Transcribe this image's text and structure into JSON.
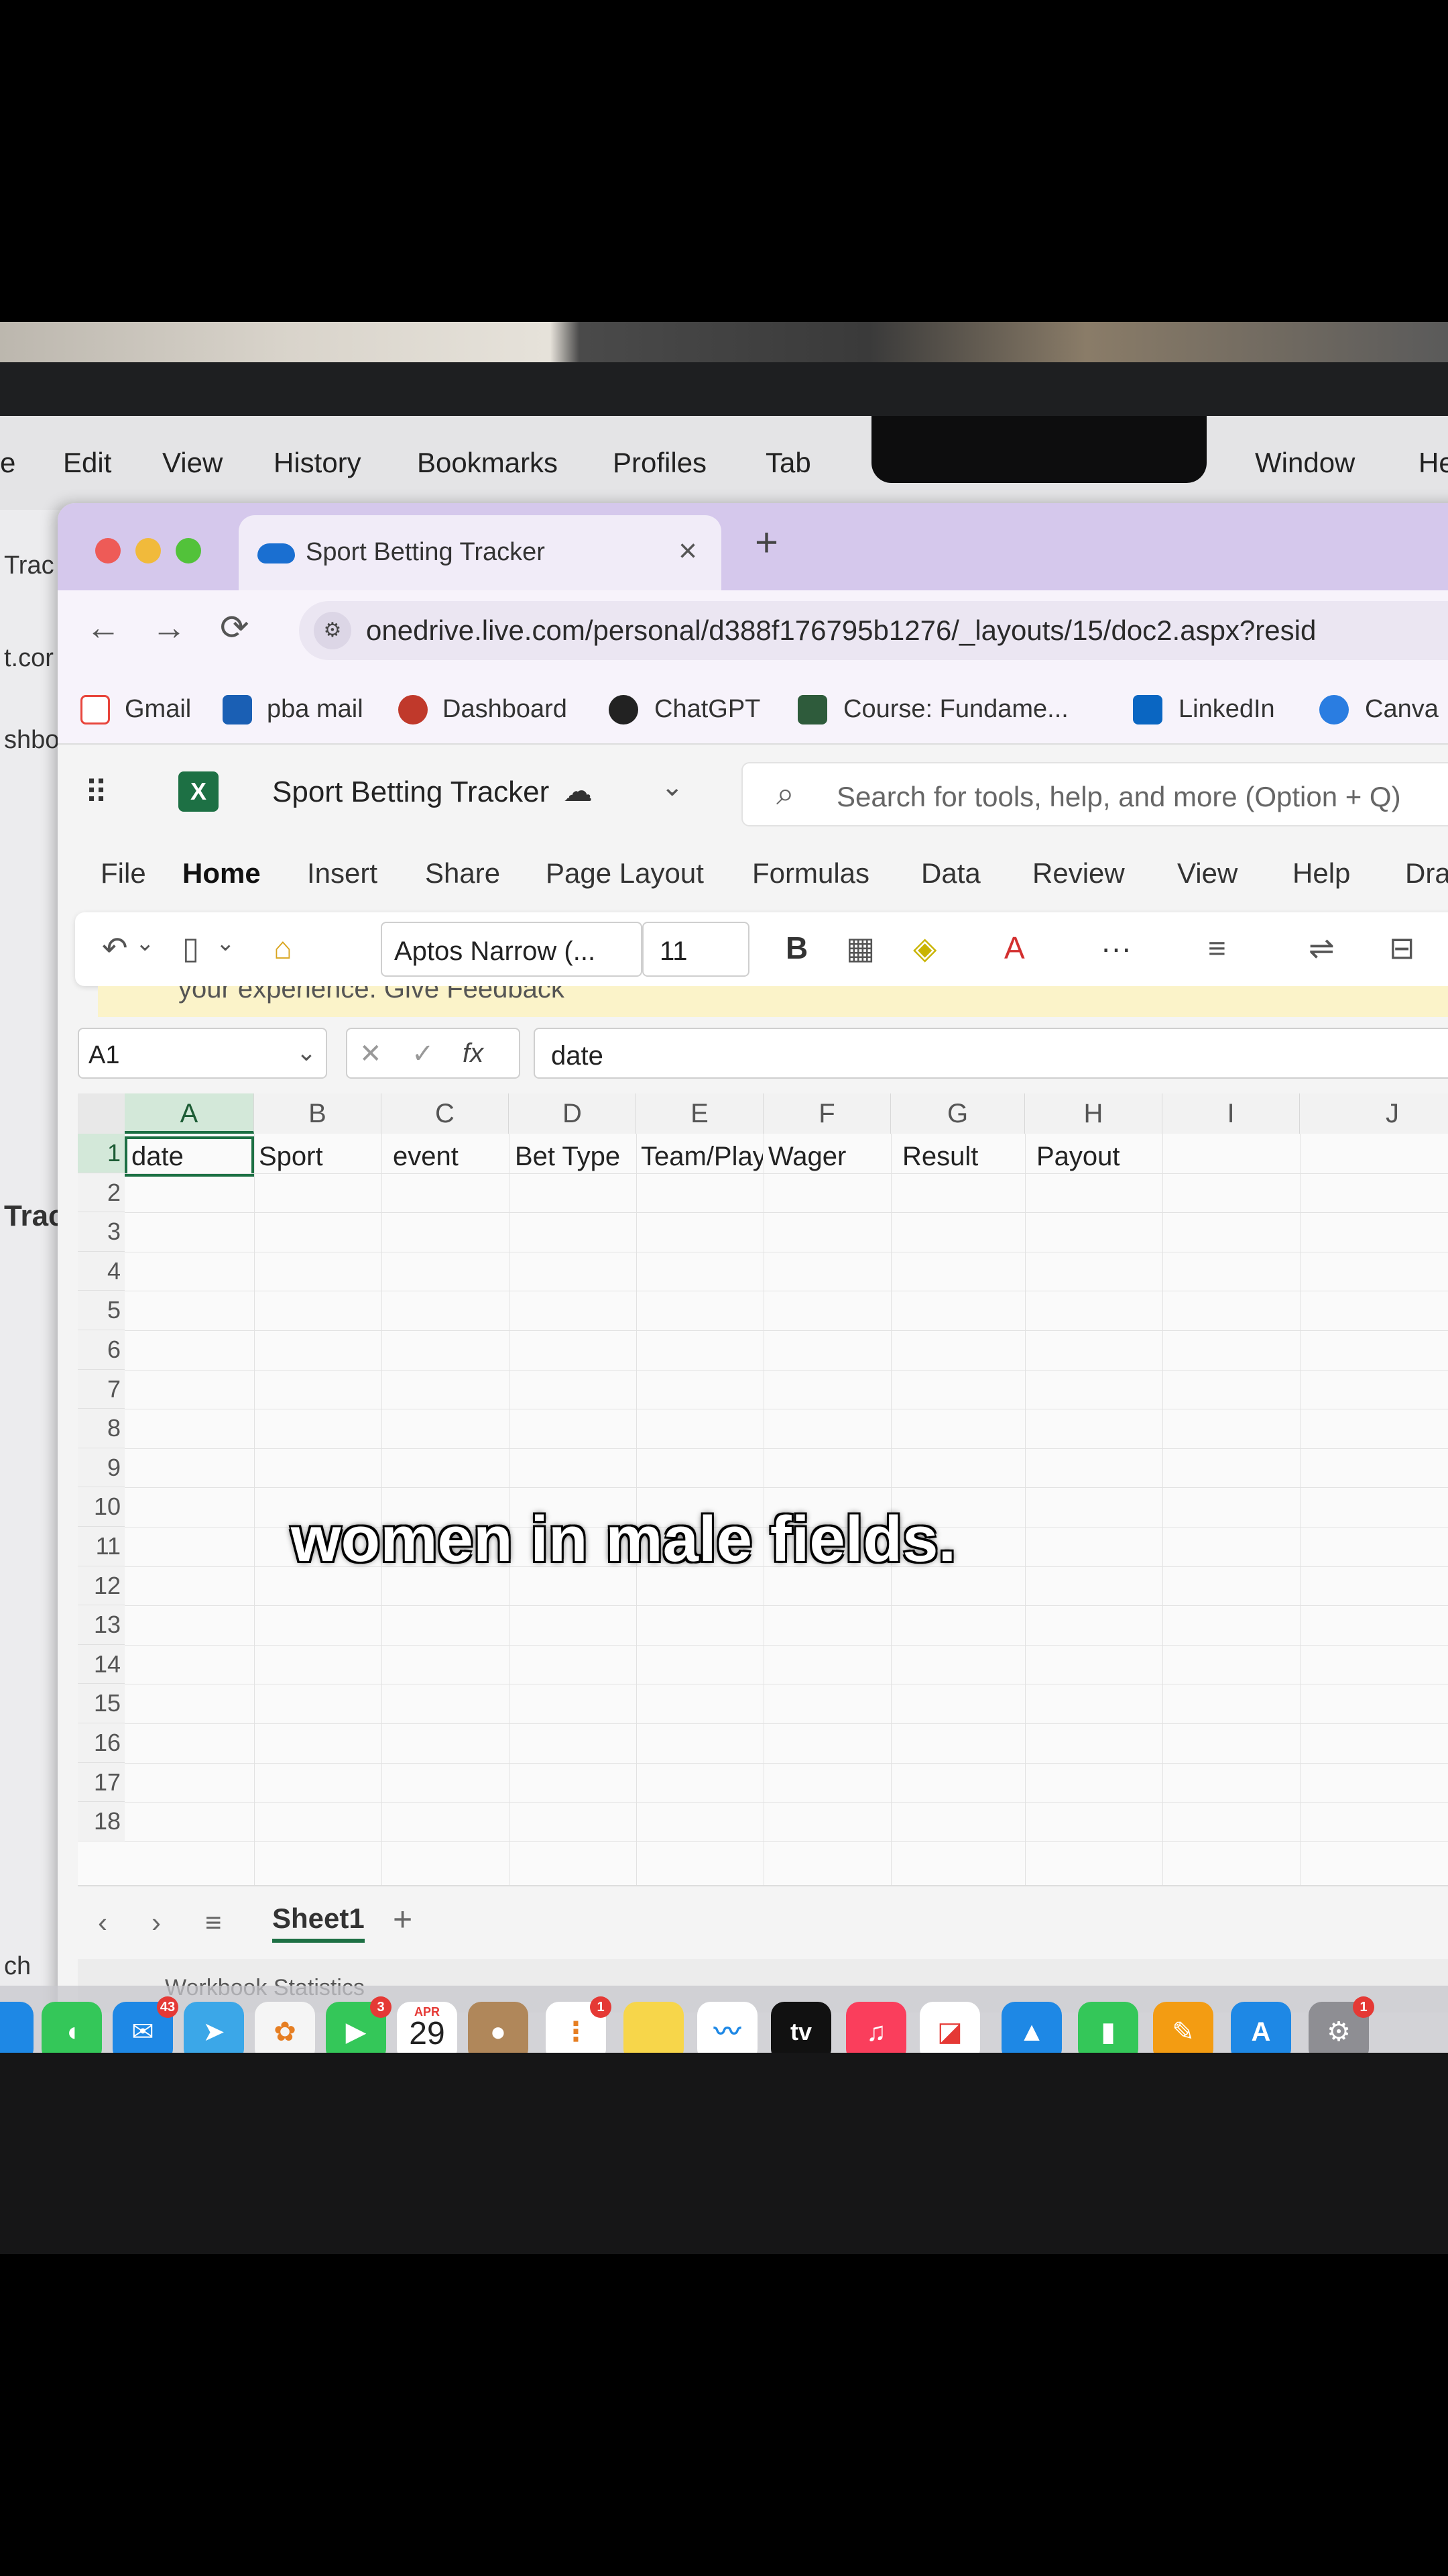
{
  "menubar": {
    "items": [
      "e",
      "Edit",
      "View",
      "History",
      "Bookmarks",
      "Profiles",
      "Tab",
      "Window",
      "He"
    ]
  },
  "background_window": {
    "labels": [
      "Trac",
      "t.cor",
      "shbo",
      "Trac",
      "ch"
    ]
  },
  "browser": {
    "tab_title": "Sport Betting Tracker",
    "tab_close": "×",
    "new_tab": "+",
    "url": "onedrive.live.com/personal/d388f176795b1276/_layouts/15/doc2.aspx?resid",
    "bookmarks": [
      "Gmail",
      "pba mail",
      "Dashboard",
      "ChatGPT",
      "Course: Fundame...",
      "LinkedIn",
      "Canva"
    ]
  },
  "excel": {
    "logo": "X",
    "doc_title": "Sport Betting Tracker",
    "search_placeholder": "Search for tools, help, and more (Option + Q)",
    "ribbon_tabs": [
      "File",
      "Home",
      "Insert",
      "Share",
      "Page Layout",
      "Formulas",
      "Data",
      "Review",
      "View",
      "Help",
      "Dra"
    ],
    "font_name": "Aptos Narrow (...",
    "font_size": "11",
    "bold_label": "B",
    "more_label": "···",
    "feedback_text": "your experience. Give Feedback",
    "name_box": "A1",
    "fx_label": "fx",
    "formula_value": "date",
    "columns": [
      "A",
      "B",
      "C",
      "D",
      "E",
      "F",
      "G",
      "H",
      "I",
      "J"
    ],
    "rows": [
      "1",
      "2",
      "3",
      "4",
      "5",
      "6",
      "7",
      "8",
      "9",
      "10",
      "11",
      "12",
      "13",
      "14",
      "15",
      "16",
      "17",
      "18"
    ],
    "row1_cells": [
      "date",
      "Sport",
      "event",
      "Bet Type",
      "Team/Play",
      "Wager",
      "Result",
      "Payout"
    ],
    "sheet_tab": "Sheet1",
    "add_sheet": "+",
    "status_text": "Workbook Statistics"
  },
  "dock": {
    "calendar_month": "APR",
    "calendar_day": "29",
    "mail_badge": "43",
    "facetime_badge": "3",
    "reminders_badge": "1",
    "settings_badge": "1",
    "tv_label": "tv"
  },
  "caption": "women in male fields."
}
